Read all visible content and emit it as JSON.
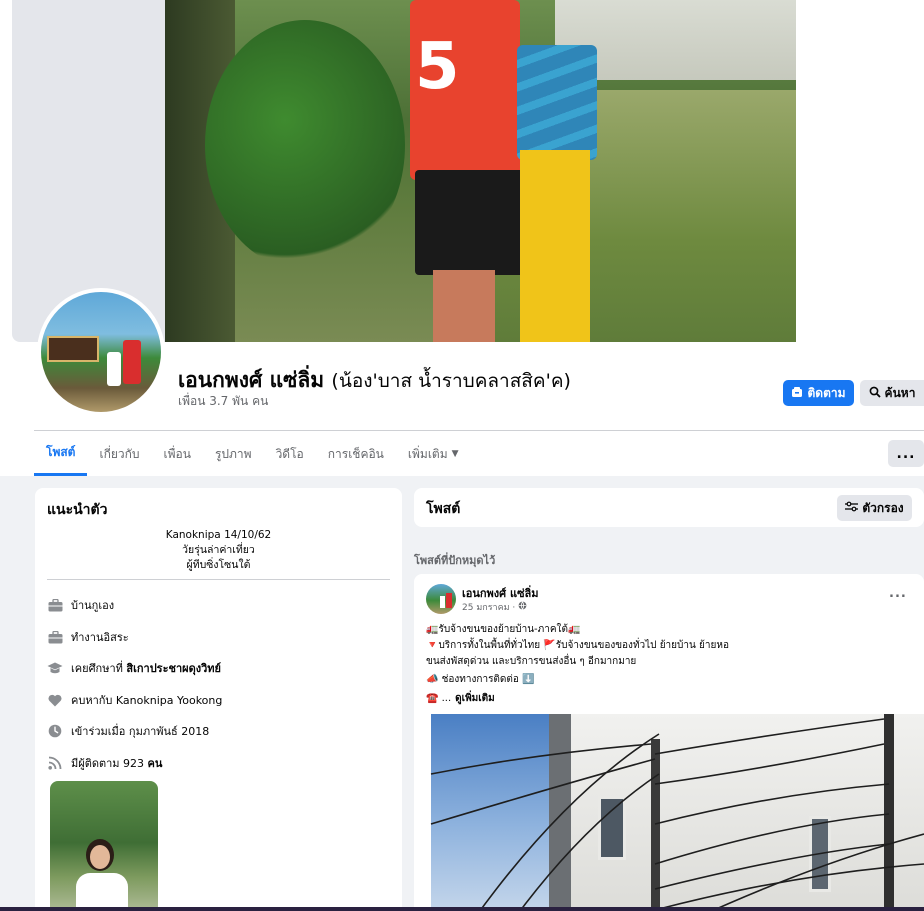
{
  "profile": {
    "name": "เอนกพงศ์ แซ่ลิ่ม",
    "nickname": "(น้อง'บาส น้ำราบคลาสสิค'ค)",
    "friends": "เพื่อน 3.7 พัน คน",
    "follow_label": "ติดตาม",
    "search_label": "ค้นหา",
    "more_label": "..."
  },
  "tabs": [
    {
      "label": "โพสต์",
      "active": true
    },
    {
      "label": "เกี่ยวกับ"
    },
    {
      "label": "เพื่อน"
    },
    {
      "label": "รูปภาพ"
    },
    {
      "label": "วิดีโอ"
    },
    {
      "label": "การเช็คอิน"
    },
    {
      "label": "เพิ่มเติม"
    }
  ],
  "intro": {
    "title": "แนะนำตัว",
    "bio": [
      "Kanoknipa 14/10/62",
      "วัยรุ่นล่าค่าเที่ยว",
      "ผู้ทีบซิ่งโซนใต้"
    ],
    "items": [
      {
        "icon": "briefcase-icon",
        "text": "บ้านกูเอง",
        "bold": ""
      },
      {
        "icon": "briefcase-icon",
        "text": "ทำงานอิสระ",
        "bold": ""
      },
      {
        "icon": "graduation-cap-icon",
        "text": "เคยศึกษาที่ ",
        "bold": "สิเกาประชาผดุงวิทย์"
      },
      {
        "icon": "heart-icon",
        "text": "คบหากับ Kanoknipa Yookong",
        "bold": ""
      },
      {
        "icon": "clock-icon",
        "text": "เข้าร่วมเมื่อ กุมภาพันธ์ 2018",
        "bold": ""
      },
      {
        "icon": "rss-icon",
        "text": "มีผู้ติดตาม 923 ",
        "bold": "คน"
      }
    ]
  },
  "posts_header": {
    "title": "โพสต์",
    "filter_label": "ตัวกรอง"
  },
  "pinned_label": "โพสต์ที่ปักหมุดไว้",
  "post": {
    "author": "เอนกพงศ์ แซ่ลิ่ม",
    "date": "25 มกราคม ·",
    "options": "...",
    "lines": [
      "🚛รับจ้างขนของย้ายบ้าน-ภาคใต้🚛",
      "🔻บริการทั้งในพื้นที่ทั่วไทย 🚩รับจ้างขนของของทั่วไป ย้ายบ้าน ย้ายหอ",
      "ขนส่งพัสดุด่วน และบริการขนส่งอื่น ๆ อีกมากมาย"
    ],
    "contact": "📣 ช่องทางการติดต่อ ⬇️",
    "phone_prefix": "☎️ ...",
    "see_more": "ดูเพิ่มเติม"
  },
  "colors": {
    "accent": "#1877f2",
    "background": "#f0f2f5",
    "card": "#ffffff",
    "secondary_text": "#65676b"
  }
}
